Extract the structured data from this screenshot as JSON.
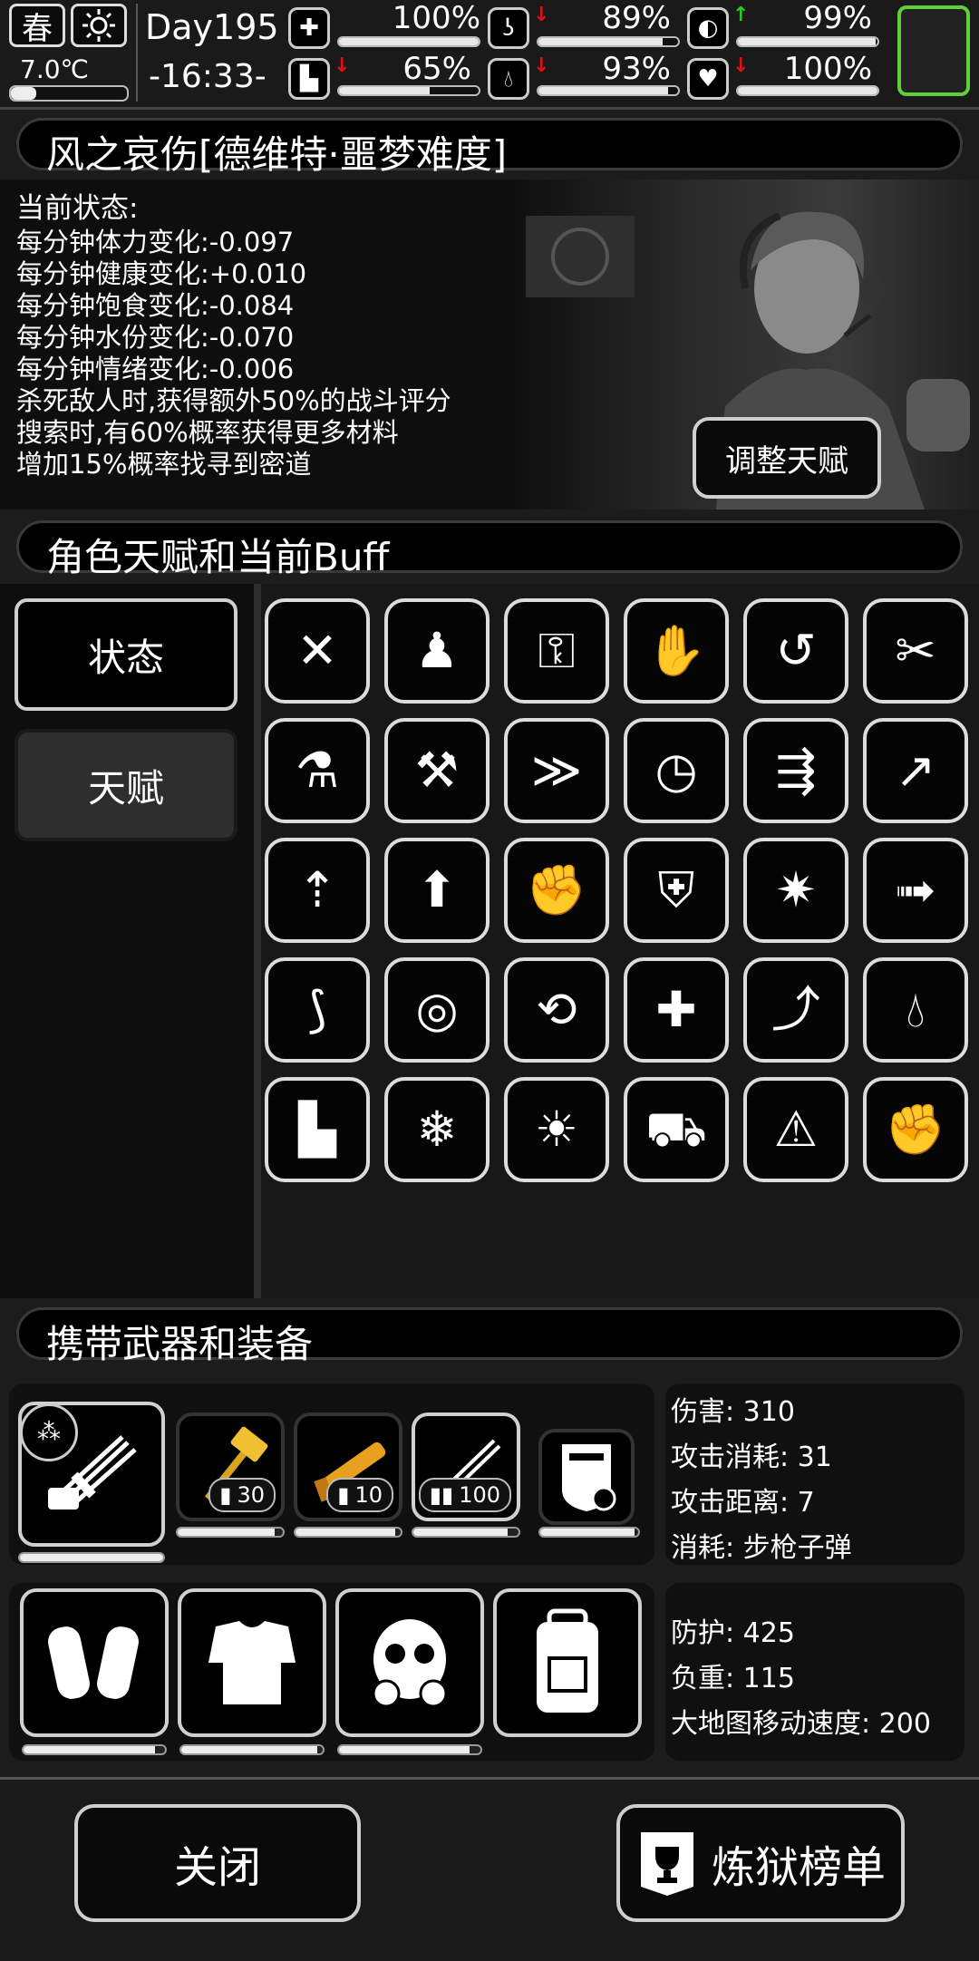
{
  "topbar": {
    "season": "春",
    "weather_icon": "sun-icon",
    "temperature": "7.0℃",
    "day": "Day195",
    "time": "-16:33-",
    "stats": [
      {
        "name": "health",
        "icon": "first-aid-icon",
        "value": "100%",
        "fill": 1.0,
        "trend": ""
      },
      {
        "name": "hunger",
        "icon": "stomach-icon",
        "value": "89%",
        "fill": 0.89,
        "trend": "down"
      },
      {
        "name": "mood",
        "icon": "pill-icon",
        "value": "99%",
        "fill": 0.99,
        "trend": "up"
      },
      {
        "name": "stamina",
        "icon": "boot-icon",
        "value": "65%",
        "fill": 0.65,
        "trend": "down"
      },
      {
        "name": "water",
        "icon": "water-drop-icon",
        "value": "93%",
        "fill": 0.93,
        "trend": "down"
      },
      {
        "name": "emotion",
        "icon": "heart-icon",
        "value": "100%",
        "fill": 1.0,
        "trend": "down"
      }
    ],
    "trend_colors": {
      "up": "#22cc22",
      "down": "#dd1111"
    },
    "slot_border_color": "#5fd03a"
  },
  "character": {
    "title": "风之哀伤[德维特·噩梦难度]",
    "status_heading": "当前状态:",
    "status_lines": [
      "每分钟体力变化:-0.097",
      "每分钟健康变化:+0.010",
      "每分钟饱食变化:-0.084",
      "每分钟水份变化:-0.070",
      "每分钟情绪变化:-0.006",
      "杀死敌人时,获得额外50%的战斗评分",
      "搜索时,有60%概率获得更多材料",
      "增加15%概率找寻到密道"
    ],
    "adjust_talent_label": "调整天赋"
  },
  "talents": {
    "section_title": "角色天赋和当前Buff",
    "tabs": [
      {
        "label": "状态",
        "active": false
      },
      {
        "label": "天赋",
        "active": true
      }
    ],
    "icons": [
      "crossed-axes-icon",
      "bag-icon",
      "lockpick-icon",
      "handshake-icon",
      "recycle-arrow-icon",
      "tools-icon",
      "flask-icon",
      "hammer-plant-icon",
      "shoe-speed-icon",
      "shoe-clock-icon",
      "shoe-boost-icon",
      "bat-up-icon",
      "gun-up-icon",
      "armor-up-icon",
      "fist-fire-icon",
      "shield-up-icon",
      "explosion-icon",
      "sprint-icon",
      "stomach-cut-icon",
      "target-up-icon",
      "claw-arm-icon",
      "medkit-up-icon",
      "stomach-up-icon",
      "water-up-icon",
      "boot-up-icon",
      "snowflake-up-icon",
      "sun-up-icon",
      "car-icon",
      "car-warning-icon",
      "flexing-arm-icon"
    ]
  },
  "equipment": {
    "section_title": "携带武器和装备",
    "weapons": [
      {
        "icon": "minigun-icon",
        "badge_icon": "spray-icon",
        "count": "",
        "durability": 1.0
      },
      {
        "icon": "golden-hammer-icon",
        "count": "30",
        "durability": 0.92
      },
      {
        "icon": "golden-rifle-icon",
        "count": "10",
        "durability": 0.95
      },
      {
        "icon": "minigun-icon",
        "count": "100",
        "durability": 0.9
      },
      {
        "icon": "riot-shield-icon",
        "count": "",
        "durability": 0.96
      }
    ],
    "weapon_stats": [
      "伤害: 310",
      "攻击消耗: 31",
      "攻击距离: 7",
      "消耗: 步枪子弹"
    ],
    "armor": [
      {
        "icon": "arm-guards-icon",
        "durability": 0.93
      },
      {
        "icon": "body-armor-icon",
        "durability": 0.96
      },
      {
        "icon": "gas-mask-icon",
        "durability": 0.92
      },
      {
        "icon": "backpack-icon",
        "durability": 0.0
      }
    ],
    "armor_stats": [
      "防护: 425",
      "负重: 115",
      "大地图移动速度: 200"
    ]
  },
  "footer": {
    "close_label": "关闭",
    "ranking_label": "炼狱榜单",
    "ranking_icon": "trophy-banner-icon"
  }
}
